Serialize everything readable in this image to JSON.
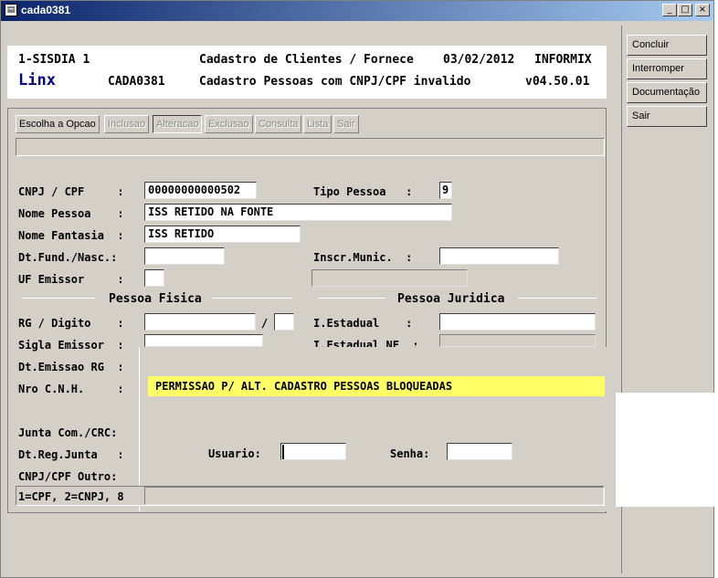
{
  "window": {
    "title": "cada0381",
    "buttons": [
      "_",
      "□",
      "×"
    ]
  },
  "header": {
    "line1_left": "1-SISDIA 1",
    "line1_center": "Cadastro de Clientes / Fornece",
    "line1_date": "03/02/2012",
    "line1_right": "INFORMIX",
    "brand": "Linx",
    "program": "CADA0381",
    "line2_center": "Cadastro Pessoas com CNPJ/CPF invalido",
    "version": "v04.50.01"
  },
  "right_buttons": [
    "Concluir",
    "Interromper",
    "Documentação",
    "Sair"
  ],
  "toolbar": [
    {
      "label": "Escolha a Opcao",
      "state": "normal"
    },
    {
      "label": "Inclusao",
      "state": "disabled"
    },
    {
      "label": "Alteracao",
      "state": "pressed"
    },
    {
      "label": "Exclusao",
      "state": "disabled"
    },
    {
      "label": "Consulta",
      "state": "disabled"
    },
    {
      "label": "Lista",
      "state": "disabled"
    },
    {
      "label": "Sair",
      "state": "disabled"
    }
  ],
  "form": {
    "cnpj_label": "CNPJ / CPF     :",
    "cnpj_value": "00000000000502",
    "tipo_label": "Tipo Pessoa   :",
    "tipo_value": "9",
    "nome_label": "Nome Pessoa    :",
    "nome_value": "ISS RETIDO NA FONTE",
    "fantasia_label": "Nome Fantasia  :",
    "fantasia_value": "ISS RETIDO",
    "dtfund_label": "Dt.Fund./Nasc.:",
    "dtfund_value": "",
    "inscr_label": "Inscr.Munic.  :",
    "inscr_value": "",
    "uf_label": "UF Emissor     :",
    "uf_value": "",
    "pf_header": "Pessoa Fisica",
    "pj_header": "Pessoa Juridica",
    "rg_label": "RG / Digito    :",
    "rg_value": "",
    "rg_sep": "/",
    "rg_digit": "",
    "ie_label": "I.Estadual    :",
    "ie_value": "",
    "sigla_label": "Sigla Emissor  :",
    "ienf_label": "I.Estadual NF  :",
    "dtemissao_label": "Dt.Emissao RG  :",
    "cnh_label": "Nro C.N.H.     :",
    "junta_label": "Junta Com./CRC:",
    "dtreg_label": "Dt.Reg.Junta   :",
    "cnpjoutro_label": "CNPJ/CPF Outro:"
  },
  "dialog": {
    "message": "PERMISSAO P/ ALT. CADASTRO PESSOAS BLOQUEADAS",
    "usuario_label": "Usuario:",
    "usuario_value": "",
    "senha_label": "Senha:",
    "senha_value": ""
  },
  "status": {
    "hint": "1=CPF, 2=CNPJ, 8"
  }
}
